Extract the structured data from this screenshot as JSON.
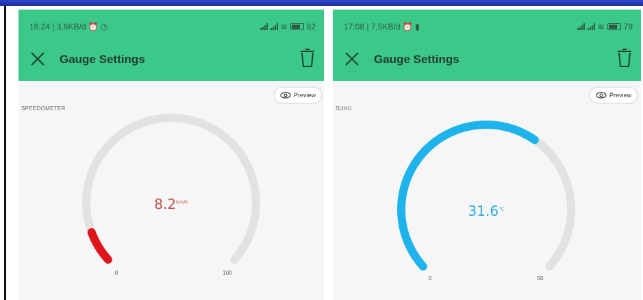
{
  "left": {
    "status": {
      "time_info": "16:24 | 3,6KB/d ⏰ ◷",
      "battery": "82"
    },
    "title": "Gauge Settings",
    "preview_label": "Preview",
    "gauge_label": "SPEEDOMETER",
    "gauge": {
      "value": "8.2",
      "unit": "km/h",
      "min": "0",
      "max": "100",
      "fill_fraction": 0.082,
      "color": "#e0141b"
    },
    "value_color": "#c0504d"
  },
  "right": {
    "status": {
      "time_info": "17:08 | 7,5KB/d ⏰ ▮",
      "battery": "79"
    },
    "title": "Gauge Settings",
    "preview_label": "Preview",
    "gauge_label": "SUHU",
    "gauge": {
      "value": "31.6",
      "unit": "°C",
      "min": "0",
      "max": "50",
      "fill_fraction": 0.632,
      "color": "#1eb3ea"
    },
    "value_color": "#2aa9dd"
  },
  "colors": {
    "header": "#3cc889",
    "track": "#e2e2e2",
    "background": "#f6f6f6"
  }
}
